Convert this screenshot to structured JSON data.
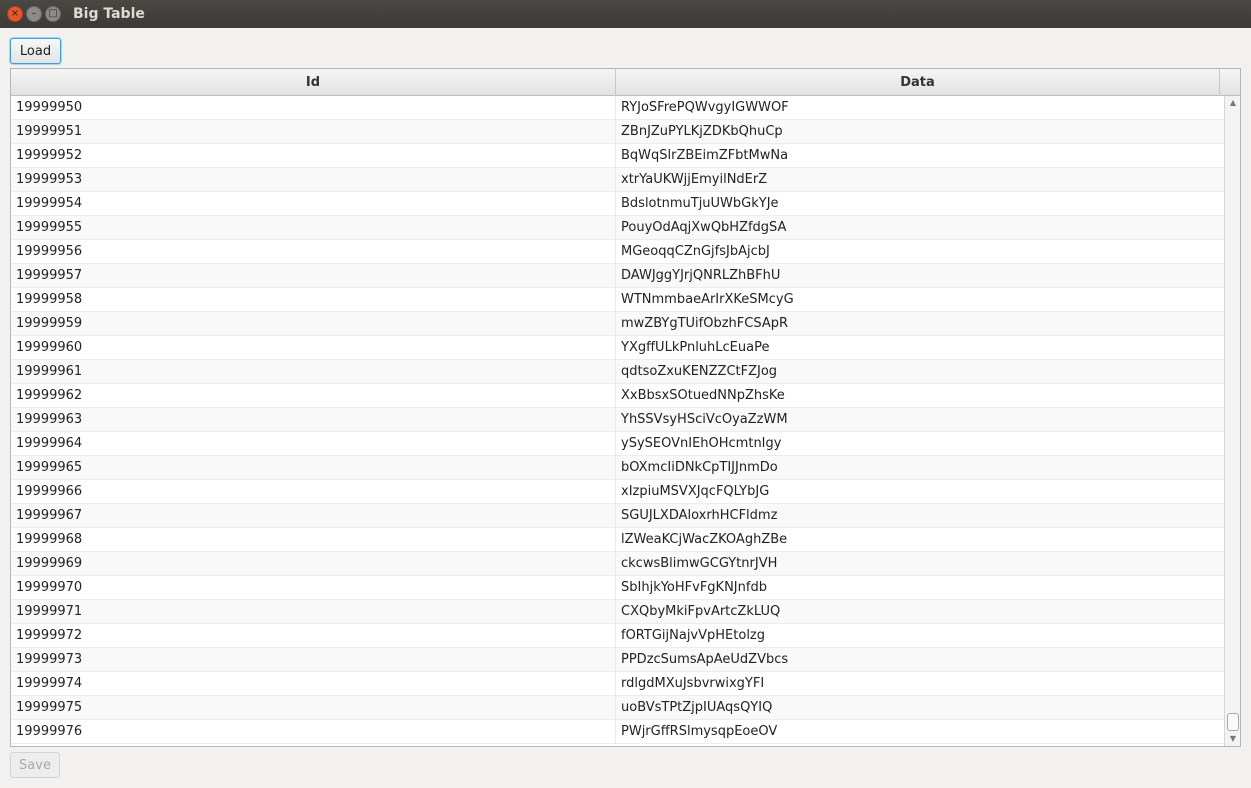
{
  "window": {
    "title": "Big Table",
    "close_glyph": "×",
    "minimize_glyph": "–",
    "maximize_glyph": "□"
  },
  "toolbar": {
    "load_label": "Load"
  },
  "table": {
    "columns": [
      "Id",
      "Data"
    ],
    "rows": [
      {
        "id": "19999950",
        "data": "RYJoSFrePQWvgyIGWWOF"
      },
      {
        "id": "19999951",
        "data": "ZBnJZuPYLKjZDKbQhuCp"
      },
      {
        "id": "19999952",
        "data": "BqWqSlrZBEimZFbtMwNa"
      },
      {
        "id": "19999953",
        "data": "xtrYaUKWjjEmyilNdErZ"
      },
      {
        "id": "19999954",
        "data": "BdslotnmuTjuUWbGkYJe"
      },
      {
        "id": "19999955",
        "data": "PouyOdAqjXwQbHZfdgSA"
      },
      {
        "id": "19999956",
        "data": "MGeoqqCZnGjfsJbAjcbJ"
      },
      {
        "id": "19999957",
        "data": "DAWJggYJrjQNRLZhBFhU"
      },
      {
        "id": "19999958",
        "data": "WTNmmbaeArIrXKeSMcyG"
      },
      {
        "id": "19999959",
        "data": "mwZBYgTUifObzhFCSApR"
      },
      {
        "id": "19999960",
        "data": "YXgffULkPnluhLcEuaPe"
      },
      {
        "id": "19999961",
        "data": "qdtsoZxuKENZZCtFZJog"
      },
      {
        "id": "19999962",
        "data": "XxBbsxSOtuedNNpZhsKe"
      },
      {
        "id": "19999963",
        "data": "YhSSVsyHSciVcOyaZzWM"
      },
      {
        "id": "19999964",
        "data": "ySySEOVnIEhOHcmtnIgy"
      },
      {
        "id": "19999965",
        "data": "bOXmcIiDNkCpTIJJnmDo"
      },
      {
        "id": "19999966",
        "data": "xIzpiuMSVXJqcFQLYbJG"
      },
      {
        "id": "19999967",
        "data": "SGUJLXDAloxrhHCFldmz"
      },
      {
        "id": "19999968",
        "data": "lZWeaKCjWacZKOAghZBe"
      },
      {
        "id": "19999969",
        "data": "ckcwsBlimwGCGYtnrJVH"
      },
      {
        "id": "19999970",
        "data": "SbIhjkYoHFvFgKNJnfdb"
      },
      {
        "id": "19999971",
        "data": "CXQbyMkiFpvArtcZkLUQ"
      },
      {
        "id": "19999972",
        "data": "fORTGijNajvVpHEtolzg"
      },
      {
        "id": "19999973",
        "data": "PPDzcSumsApAeUdZVbcs"
      },
      {
        "id": "19999974",
        "data": "rdlgdMXuJsbvrwixgYFI"
      },
      {
        "id": "19999975",
        "data": "uoBVsTPtZjpIUAqsQYIQ"
      },
      {
        "id": "19999976",
        "data": "PWjrGffRSlmysqpEoeOV"
      }
    ]
  },
  "footer": {
    "save_label": "Save",
    "save_disabled": true
  },
  "colors": {
    "focus_border": "#3aa0d8",
    "titlebar": "#3b3a36",
    "close_button": "#e5572f"
  },
  "icons": {
    "close": "close-icon",
    "minimize": "minimize-icon",
    "maximize": "maximize-icon",
    "scroll_up": "chevron-up-icon",
    "scroll_down": "chevron-down-icon"
  }
}
